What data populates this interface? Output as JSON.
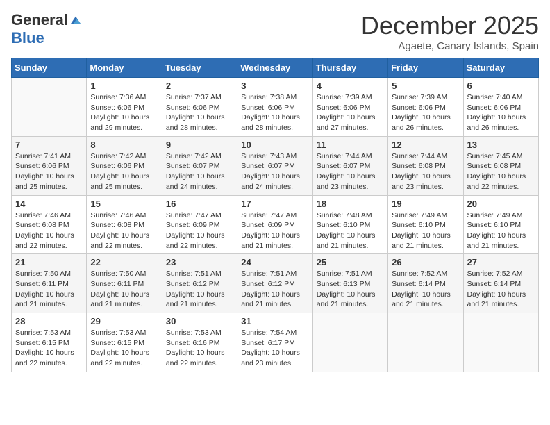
{
  "header": {
    "logo_general": "General",
    "logo_blue": "Blue",
    "month_title": "December 2025",
    "subtitle": "Agaete, Canary Islands, Spain"
  },
  "weekdays": [
    "Sunday",
    "Monday",
    "Tuesday",
    "Wednesday",
    "Thursday",
    "Friday",
    "Saturday"
  ],
  "weeks": [
    [
      {
        "day": "",
        "sunrise": "",
        "sunset": "",
        "daylight": "",
        "empty": true
      },
      {
        "day": "1",
        "sunrise": "7:36 AM",
        "sunset": "6:06 PM",
        "daylight": "10 hours and 29 minutes."
      },
      {
        "day": "2",
        "sunrise": "7:37 AM",
        "sunset": "6:06 PM",
        "daylight": "10 hours and 28 minutes."
      },
      {
        "day": "3",
        "sunrise": "7:38 AM",
        "sunset": "6:06 PM",
        "daylight": "10 hours and 28 minutes."
      },
      {
        "day": "4",
        "sunrise": "7:39 AM",
        "sunset": "6:06 PM",
        "daylight": "10 hours and 27 minutes."
      },
      {
        "day": "5",
        "sunrise": "7:39 AM",
        "sunset": "6:06 PM",
        "daylight": "10 hours and 26 minutes."
      },
      {
        "day": "6",
        "sunrise": "7:40 AM",
        "sunset": "6:06 PM",
        "daylight": "10 hours and 26 minutes."
      }
    ],
    [
      {
        "day": "7",
        "sunrise": "7:41 AM",
        "sunset": "6:06 PM",
        "daylight": "10 hours and 25 minutes."
      },
      {
        "day": "8",
        "sunrise": "7:42 AM",
        "sunset": "6:06 PM",
        "daylight": "10 hours and 25 minutes."
      },
      {
        "day": "9",
        "sunrise": "7:42 AM",
        "sunset": "6:07 PM",
        "daylight": "10 hours and 24 minutes."
      },
      {
        "day": "10",
        "sunrise": "7:43 AM",
        "sunset": "6:07 PM",
        "daylight": "10 hours and 24 minutes."
      },
      {
        "day": "11",
        "sunrise": "7:44 AM",
        "sunset": "6:07 PM",
        "daylight": "10 hours and 23 minutes."
      },
      {
        "day": "12",
        "sunrise": "7:44 AM",
        "sunset": "6:08 PM",
        "daylight": "10 hours and 23 minutes."
      },
      {
        "day": "13",
        "sunrise": "7:45 AM",
        "sunset": "6:08 PM",
        "daylight": "10 hours and 22 minutes."
      }
    ],
    [
      {
        "day": "14",
        "sunrise": "7:46 AM",
        "sunset": "6:08 PM",
        "daylight": "10 hours and 22 minutes."
      },
      {
        "day": "15",
        "sunrise": "7:46 AM",
        "sunset": "6:08 PM",
        "daylight": "10 hours and 22 minutes."
      },
      {
        "day": "16",
        "sunrise": "7:47 AM",
        "sunset": "6:09 PM",
        "daylight": "10 hours and 22 minutes."
      },
      {
        "day": "17",
        "sunrise": "7:47 AM",
        "sunset": "6:09 PM",
        "daylight": "10 hours and 21 minutes."
      },
      {
        "day": "18",
        "sunrise": "7:48 AM",
        "sunset": "6:10 PM",
        "daylight": "10 hours and 21 minutes."
      },
      {
        "day": "19",
        "sunrise": "7:49 AM",
        "sunset": "6:10 PM",
        "daylight": "10 hours and 21 minutes."
      },
      {
        "day": "20",
        "sunrise": "7:49 AM",
        "sunset": "6:10 PM",
        "daylight": "10 hours and 21 minutes."
      }
    ],
    [
      {
        "day": "21",
        "sunrise": "7:50 AM",
        "sunset": "6:11 PM",
        "daylight": "10 hours and 21 minutes."
      },
      {
        "day": "22",
        "sunrise": "7:50 AM",
        "sunset": "6:11 PM",
        "daylight": "10 hours and 21 minutes."
      },
      {
        "day": "23",
        "sunrise": "7:51 AM",
        "sunset": "6:12 PM",
        "daylight": "10 hours and 21 minutes."
      },
      {
        "day": "24",
        "sunrise": "7:51 AM",
        "sunset": "6:12 PM",
        "daylight": "10 hours and 21 minutes."
      },
      {
        "day": "25",
        "sunrise": "7:51 AM",
        "sunset": "6:13 PM",
        "daylight": "10 hours and 21 minutes."
      },
      {
        "day": "26",
        "sunrise": "7:52 AM",
        "sunset": "6:14 PM",
        "daylight": "10 hours and 21 minutes."
      },
      {
        "day": "27",
        "sunrise": "7:52 AM",
        "sunset": "6:14 PM",
        "daylight": "10 hours and 21 minutes."
      }
    ],
    [
      {
        "day": "28",
        "sunrise": "7:53 AM",
        "sunset": "6:15 PM",
        "daylight": "10 hours and 22 minutes."
      },
      {
        "day": "29",
        "sunrise": "7:53 AM",
        "sunset": "6:15 PM",
        "daylight": "10 hours and 22 minutes."
      },
      {
        "day": "30",
        "sunrise": "7:53 AM",
        "sunset": "6:16 PM",
        "daylight": "10 hours and 22 minutes."
      },
      {
        "day": "31",
        "sunrise": "7:54 AM",
        "sunset": "6:17 PM",
        "daylight": "10 hours and 23 minutes."
      },
      {
        "day": "",
        "sunrise": "",
        "sunset": "",
        "daylight": "",
        "empty": true
      },
      {
        "day": "",
        "sunrise": "",
        "sunset": "",
        "daylight": "",
        "empty": true
      },
      {
        "day": "",
        "sunrise": "",
        "sunset": "",
        "daylight": "",
        "empty": true
      }
    ]
  ],
  "labels": {
    "sunrise_prefix": "Sunrise: ",
    "sunset_prefix": "Sunset: ",
    "daylight_prefix": "Daylight: "
  }
}
